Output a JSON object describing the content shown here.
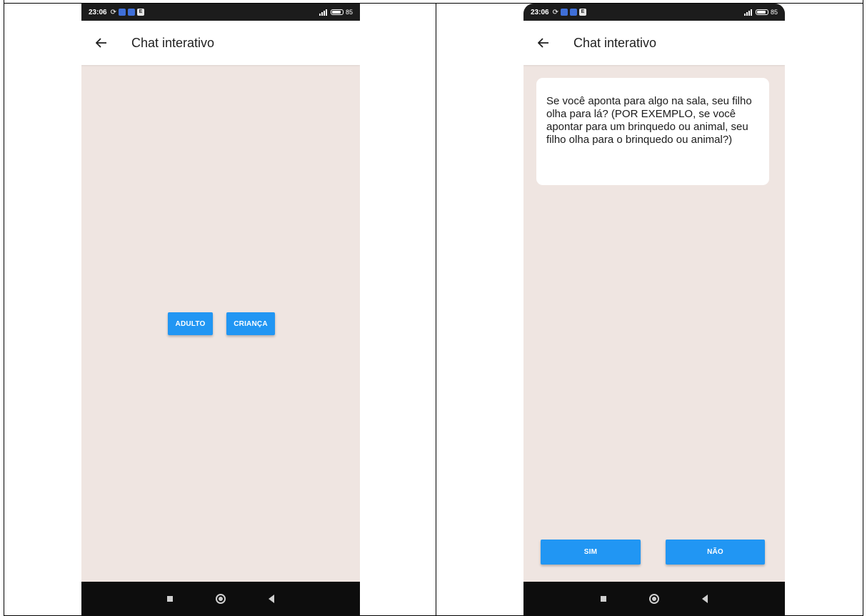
{
  "left_screen": {
    "status": {
      "time": "23:06",
      "battery": "85"
    },
    "appbar": {
      "title": "Chat interativo"
    },
    "buttons": {
      "adulto": "ADULTO",
      "crianca": "CRIANÇA"
    }
  },
  "right_screen": {
    "status": {
      "time": "23:06",
      "battery": "85"
    },
    "appbar": {
      "title": "Chat interativo"
    },
    "question": "Se você aponta para algo na sala, seu filho olha para lá? (POR EXEMPLO, se você apontar para um brinquedo ou animal, seu filho olha para o brinquedo ou animal?)",
    "buttons": {
      "sim": "SIM",
      "nao": "NÃO"
    }
  },
  "icons": {
    "back": "arrow-left-icon",
    "sync": "sync-icon",
    "nav_recent": "square-icon",
    "nav_home": "circle-icon",
    "nav_back": "triangle-back-icon"
  },
  "colors": {
    "button_blue": "#2196f3",
    "chat_background": "#efe5e1",
    "status_bar": "#1c1c1c",
    "nav_bar": "#0d0d0d"
  }
}
